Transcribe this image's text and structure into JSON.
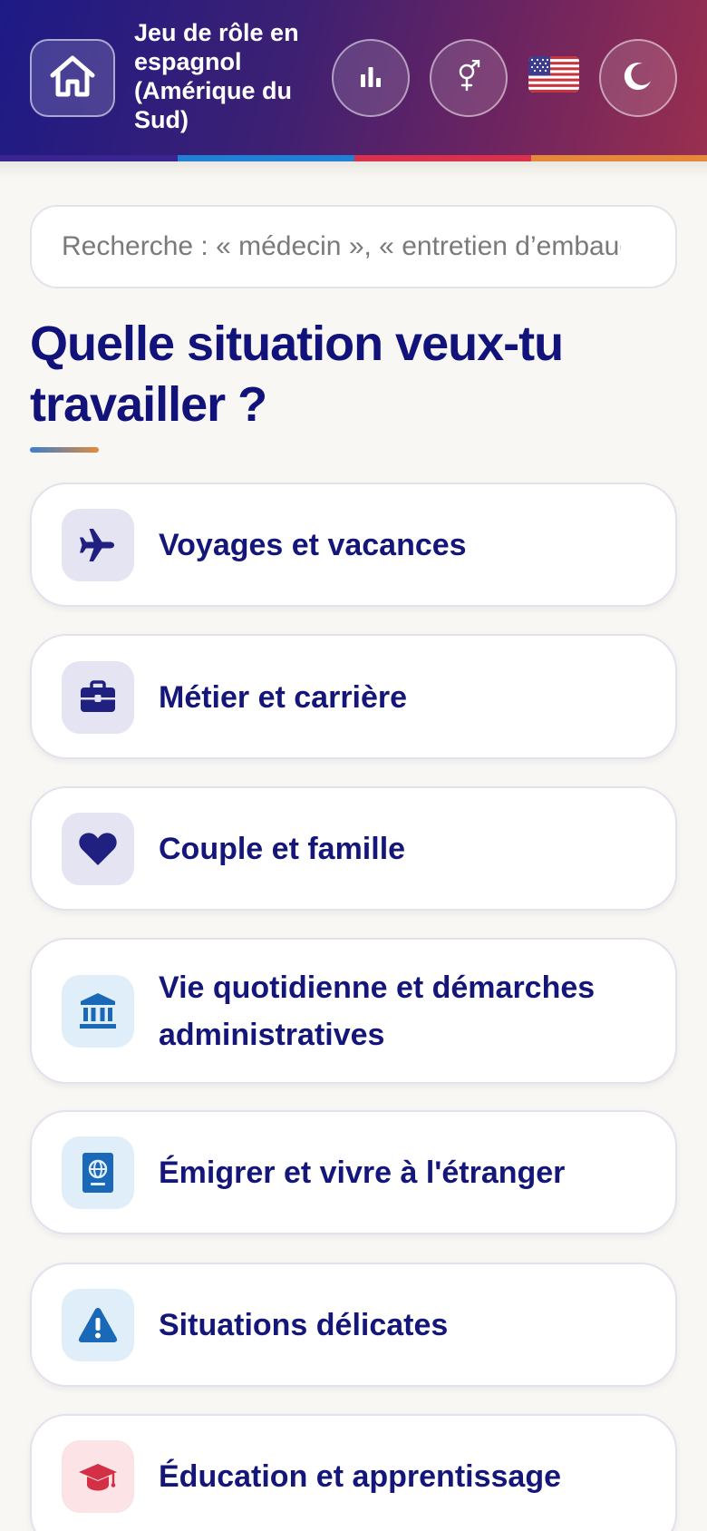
{
  "header": {
    "title": "Jeu de rôle en espagnol (Amérique du Sud)",
    "home_icon": "home-icon",
    "stats_icon": "bar-chart-icon",
    "gender_icon": "gender-icon",
    "language_flag": "us-flag",
    "theme_icon": "moon-icon",
    "stripe_colors": [
      "#3a2590",
      "#1f80d6",
      "#d9304b",
      "#e6883a"
    ]
  },
  "search": {
    "placeholder": "Recherche : « médecin », « entretien d’embauche » ..."
  },
  "main": {
    "heading": "Quelle situation veux-tu travailler ?",
    "categories": [
      {
        "label": "Voyages et vacances",
        "icon": "airplane-icon",
        "icon_color": "#1f2080",
        "icon_bg": "#e5e4f2"
      },
      {
        "label": "Métier et carrière",
        "icon": "briefcase-icon",
        "icon_color": "#1f2080",
        "icon_bg": "#e5e4f2"
      },
      {
        "label": "Couple et famille",
        "icon": "heart-icon",
        "icon_color": "#1f2080",
        "icon_bg": "#e5e4f2"
      },
      {
        "label": "Vie quotidienne et démarches administratives",
        "icon": "bank-icon",
        "icon_color": "#1a68b8",
        "icon_bg": "#dfeef9"
      },
      {
        "label": "Émigrer et vivre à l'étranger",
        "icon": "passport-icon",
        "icon_color": "#1a68b8",
        "icon_bg": "#dfeef9"
      },
      {
        "label": "Situations délicates",
        "icon": "warning-icon",
        "icon_color": "#1a68b8",
        "icon_bg": "#dfeef9"
      },
      {
        "label": "Éducation et apprentissage",
        "icon": "graduation-cap-icon",
        "icon_color": "#d32f45",
        "icon_bg": "#fbe3e6"
      }
    ]
  }
}
